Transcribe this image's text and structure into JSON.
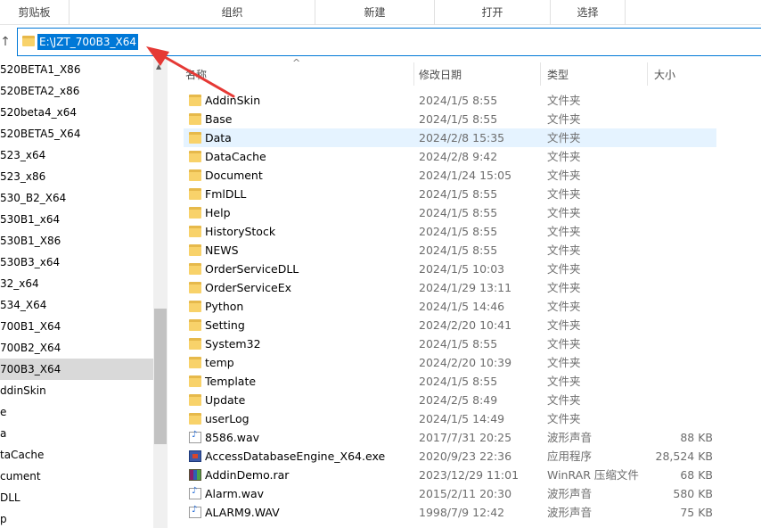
{
  "ribbon": {
    "groups": [
      "剪贴板",
      "组织",
      "新建",
      "打开",
      "选择"
    ]
  },
  "address": {
    "path": "E:\\JZT_700B3_X64"
  },
  "nav": {
    "items": [
      "520BETA1_X86",
      "520BETA2_x86",
      "520beta4_x64",
      "520BETA5_X64",
      "523_x64",
      "523_x86",
      "530_B2_X64",
      "530B1_x64",
      "530B1_X86",
      "530B3_x64",
      "32_x64",
      "534_X64",
      "700B1_X64",
      "700B2_X64",
      "700B3_X64",
      "ddinSkin",
      "e",
      "a",
      "taCache",
      "cument",
      "DLL",
      "p"
    ],
    "selected_index": 14
  },
  "columns": {
    "name": "名称",
    "date": "修改日期",
    "type": "类型",
    "size": "大小"
  },
  "files": [
    {
      "name": "AddinSkin",
      "date": "2024/1/5 8:55",
      "type": "文件夹",
      "size": "",
      "icon": "folder-icon"
    },
    {
      "name": "Base",
      "date": "2024/1/5 8:55",
      "type": "文件夹",
      "size": "",
      "icon": "folder-icon"
    },
    {
      "name": "Data",
      "date": "2024/2/8 15:35",
      "type": "文件夹",
      "size": "",
      "icon": "folder-icon"
    },
    {
      "name": "DataCache",
      "date": "2024/2/8 9:42",
      "type": "文件夹",
      "size": "",
      "icon": "folder-icon"
    },
    {
      "name": "Document",
      "date": "2024/1/24 15:05",
      "type": "文件夹",
      "size": "",
      "icon": "folder-icon"
    },
    {
      "name": "FmlDLL",
      "date": "2024/1/5 8:55",
      "type": "文件夹",
      "size": "",
      "icon": "folder-icon"
    },
    {
      "name": "Help",
      "date": "2024/1/5 8:55",
      "type": "文件夹",
      "size": "",
      "icon": "folder-icon"
    },
    {
      "name": "HistoryStock",
      "date": "2024/1/5 8:55",
      "type": "文件夹",
      "size": "",
      "icon": "folder-icon"
    },
    {
      "name": "NEWS",
      "date": "2024/1/5 8:55",
      "type": "文件夹",
      "size": "",
      "icon": "folder-icon"
    },
    {
      "name": "OrderServiceDLL",
      "date": "2024/1/5 10:03",
      "type": "文件夹",
      "size": "",
      "icon": "folder-icon"
    },
    {
      "name": "OrderServiceEx",
      "date": "2024/1/29 13:11",
      "type": "文件夹",
      "size": "",
      "icon": "folder-icon"
    },
    {
      "name": "Python",
      "date": "2024/1/5 14:46",
      "type": "文件夹",
      "size": "",
      "icon": "folder-icon"
    },
    {
      "name": "Setting",
      "date": "2024/2/20 10:41",
      "type": "文件夹",
      "size": "",
      "icon": "folder-icon"
    },
    {
      "name": "System32",
      "date": "2024/1/5 8:55",
      "type": "文件夹",
      "size": "",
      "icon": "folder-icon"
    },
    {
      "name": "temp",
      "date": "2024/2/20 10:39",
      "type": "文件夹",
      "size": "",
      "icon": "folder-icon"
    },
    {
      "name": "Template",
      "date": "2024/1/5 8:55",
      "type": "文件夹",
      "size": "",
      "icon": "folder-icon"
    },
    {
      "name": "Update",
      "date": "2024/2/5 8:49",
      "type": "文件夹",
      "size": "",
      "icon": "folder-icon"
    },
    {
      "name": "userLog",
      "date": "2024/1/5 14:49",
      "type": "文件夹",
      "size": "",
      "icon": "folder-icon"
    },
    {
      "name": "8586.wav",
      "date": "2017/7/31 20:25",
      "type": "波形声音",
      "size": "88 KB",
      "icon": "wav-icon"
    },
    {
      "name": "AccessDatabaseEngine_X64.exe",
      "date": "2020/9/23 22:36",
      "type": "应用程序",
      "size": "28,524 KB",
      "icon": "exe-icon"
    },
    {
      "name": "AddinDemo.rar",
      "date": "2023/12/29 11:01",
      "type": "WinRAR 压缩文件",
      "size": "68 KB",
      "icon": "rar-icon"
    },
    {
      "name": "Alarm.wav",
      "date": "2015/2/11 20:30",
      "type": "波形声音",
      "size": "580 KB",
      "icon": "wav-icon"
    },
    {
      "name": "ALARM9.WAV",
      "date": "1998/7/9 12:42",
      "type": "波形声音",
      "size": "75 KB",
      "icon": "wav-icon"
    }
  ],
  "selected_file_index": 2,
  "colors": {
    "accent": "#0078d7",
    "selected_row": "#e5f3ff",
    "annotation_arrow": "#e53935"
  }
}
